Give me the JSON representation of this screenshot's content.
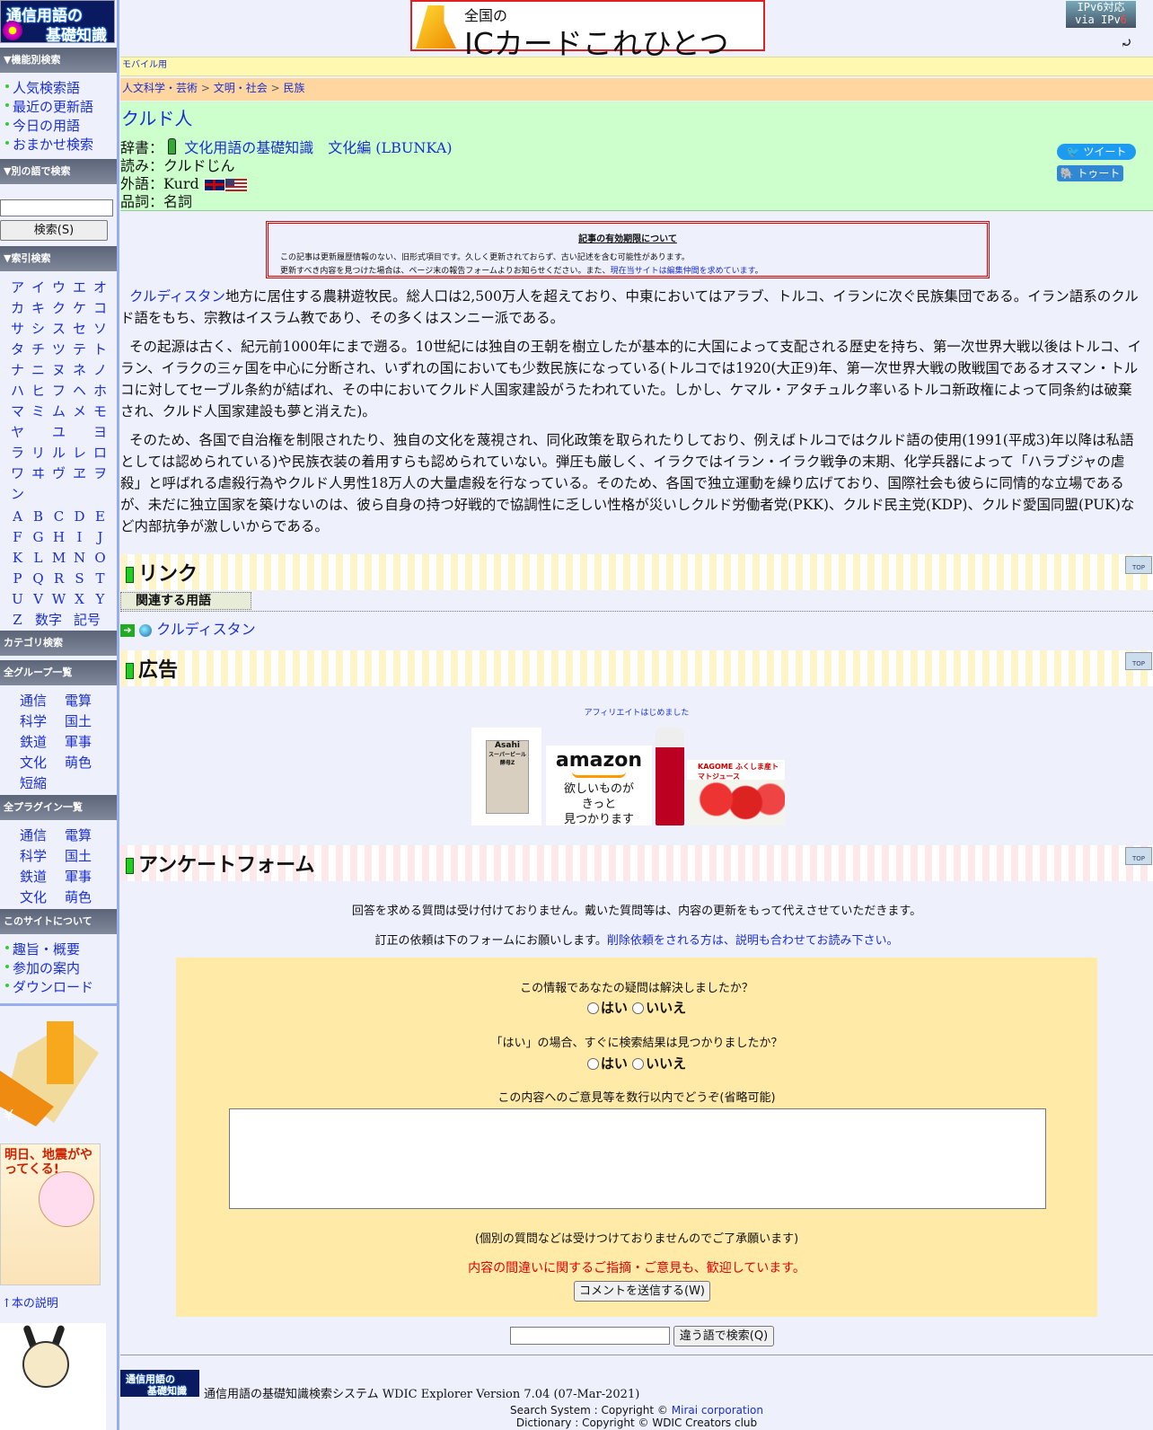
{
  "site_logo": {
    "line1": "通信用語の",
    "line2": "基礎知識"
  },
  "banner": {
    "line1": "全国の",
    "line2": "ICカードこれひとつ"
  },
  "ipv6_badge": {
    "line1": "IPv6対応",
    "line2_a": "via IPv",
    "line2_b": "6"
  },
  "mobile_link": "モバイル用",
  "breadcrumb": [
    "人文科学・芸術",
    "文明・社会",
    "民族"
  ],
  "breadcrumb_sep": ">",
  "entry": {
    "title": "クルド人",
    "dict_label": "辞書：",
    "dict_name": "文化用語の基礎知識　文化編 (LBUNKA)",
    "reading": "読み：クルドじん",
    "foreign": "外語：Kurd",
    "pos": "品詞：名詞"
  },
  "share": {
    "tweet": "ツイート",
    "toot": "トゥート"
  },
  "notice": {
    "heading": "記事の有効期限について",
    "line1": "この記事は更新履歴情報のない、旧形式項目です。久しく更新されておらず、古い記述を含む可能性があります。",
    "line2_prefix": "更新すべき内容を見つけた場合は、ページ末の報告フォームよりお知らせください。また、",
    "line2_link": "現在当サイトは編集仲間を求めています",
    "line2_suffix": "。"
  },
  "article": {
    "p1_link": "クルディスタン",
    "p1": "地方に居住する農耕遊牧民。総人口は2,500万人を超えており、中東においてはアラブ、トルコ、イランに次ぐ民族集団である。イラン語系のクルド語をもち、宗教はイスラム教であり、その多くはスンニー派である。",
    "p2": "その起源は古く、紀元前1000年にまで遡る。10世紀には独自の王朝を樹立したが基本的に大国によって支配される歴史を持ち、第一次世界大戦以後はトルコ、イラン、イラクの三ヶ国を中心に分断され、いずれの国においても少数民族になっている(トルコでは1920(大正9)年、第一次世界大戦の敗戦国であるオスマン・トルコに対してセーブル条約が結ばれ、その中においてクルド人国家建設がうたわれていた。しかし、ケマル・アタチュルク率いるトルコ新政権によって同条約は破棄され、クルド人国家建設も夢と消えた)。",
    "p3": "そのため、各国で自治権を制限されたり、独自の文化を蔑視され、同化政策を取られたりしており、例えばトルコではクルド語の使用(1991(平成3)年以降は私語としては認められている)や民族衣装の着用すらも認められていない。弾圧も厳しく、イラクではイラン・イラク戦争の末期、化学兵器によって「ハラブジャの虐殺」と呼ばれる虐殺行為やクルド人男性18万人の大量虐殺を行なっている。そのため、各国で独立運動を繰り広げており、国際社会も彼らに同情的な立場であるが、未だに独立国家を築けないのは、彼ら自身の持つ好戦的で協調性に乏しい性格が災いしクルド労働者党(PKK)、クルド民主党(KDP)、クルド愛国同盟(PUK)など内部抗争が激しいからである。"
  },
  "sections": {
    "link": "リンク",
    "ad": "広告",
    "survey": "アンケートフォーム",
    "top_label": "TOP"
  },
  "related": {
    "heading": "関連する用語",
    "items": [
      "クルディスタン"
    ]
  },
  "affiliate": "アフィリエイトはじめました",
  "ads": {
    "asahi": "Asahi",
    "asahi_sub": "スーパービール酵母Z",
    "amazon": "amazon",
    "amazon_text": "欲しいものが\nきっと\n見つかります",
    "kagome": "KAGOME ふくしま産トマトジュース"
  },
  "survey": {
    "intro1": "回答を求める質問は受け付けておりません。戴いた質問等は、内容の更新をもって代えさせていただきます。",
    "intro2": "訂正の依頼は下のフォームにお願いします。",
    "intro2_link": "削除依頼をされる方は、説明も合わせてお読み下さい。",
    "q1": "この情報であなたの疑問は解決しましたか？",
    "q2": "「はい」の場合、すぐに検索結果は見つかりましたか？",
    "q3": "この内容へのご意見等を数行以内でどうぞ(省略可能)",
    "yes": "はい",
    "no": "いいえ",
    "note": "(個別の質問などは受けつけておりませんのでご了承願います)",
    "welcome": "内容の間違いに関するご指摘・ご意見も、歓迎しています。",
    "send": "コメントを送信する(W)"
  },
  "bottom_search": {
    "button": "違う語で検索(Q)"
  },
  "footer": {
    "system": "通信用語の基礎知識検索システム WDIC Explorer Version 7.04 (07-Mar-2021)",
    "search_system_prefix": "Search System : Copyright © ",
    "search_system_link": "Mirai corporation",
    "dictionary": "Dictionary : Copyright © WDIC Creators club"
  },
  "sidebar": {
    "func_heading": "▼機能別検索",
    "func_items": [
      "人気検索語",
      "最近の更新語",
      "今日の用語",
      "おまかせ検索"
    ],
    "other_heading": "▼別の語で検索",
    "search_button": "検索(S)",
    "index_heading": "▼索引検索",
    "kana_rows": [
      [
        "ア",
        "イ",
        "ウ",
        "エ",
        "オ"
      ],
      [
        "カ",
        "キ",
        "ク",
        "ケ",
        "コ"
      ],
      [
        "サ",
        "シ",
        "ス",
        "セ",
        "ソ"
      ],
      [
        "タ",
        "チ",
        "ツ",
        "テ",
        "ト"
      ],
      [
        "ナ",
        "ニ",
        "ヌ",
        "ネ",
        "ノ"
      ],
      [
        "ハ",
        "ヒ",
        "フ",
        "ヘ",
        "ホ"
      ],
      [
        "マ",
        "ミ",
        "ム",
        "メ",
        "モ"
      ],
      [
        "ヤ",
        "",
        "ユ",
        "",
        "ヨ"
      ],
      [
        "ラ",
        "リ",
        "ル",
        "レ",
        "ロ"
      ],
      [
        "ワ",
        "ヰ",
        "ヴ",
        "ヱ",
        "ヲ"
      ],
      [
        "ン",
        "",
        "",
        "",
        ""
      ]
    ],
    "alpha_rows": [
      [
        "A",
        "B",
        "C",
        "D",
        "E"
      ],
      [
        "F",
        "G",
        "H",
        "I",
        "J"
      ],
      [
        "K",
        "L",
        "M",
        "N",
        "O"
      ],
      [
        "P",
        "Q",
        "R",
        "S",
        "T"
      ],
      [
        "U",
        "V",
        "W",
        "X",
        "Y"
      ],
      [
        "Z",
        "数字",
        "記号"
      ]
    ],
    "category_heading": "カテゴリ検索",
    "groups_heading": "全グループ一覧",
    "groups": [
      [
        "通信",
        "電算"
      ],
      [
        "科学",
        "国土"
      ],
      [
        "鉄道",
        "軍事"
      ],
      [
        "文化",
        "萌色"
      ],
      [
        "短縮"
      ]
    ],
    "plugins_heading": "全プラグイン一覧",
    "plugins": [
      [
        "通信",
        "電算"
      ],
      [
        "科学",
        "国土"
      ],
      [
        "鉄道",
        "軍事"
      ],
      [
        "文化",
        "萌色"
      ]
    ],
    "about_heading": "このサイトについて",
    "about_items": [
      "趣旨・概要",
      "参加の案内",
      "ダウンロード"
    ],
    "book_title": "明日、地震がやってくる!",
    "book_caption": "↑本の説明"
  }
}
